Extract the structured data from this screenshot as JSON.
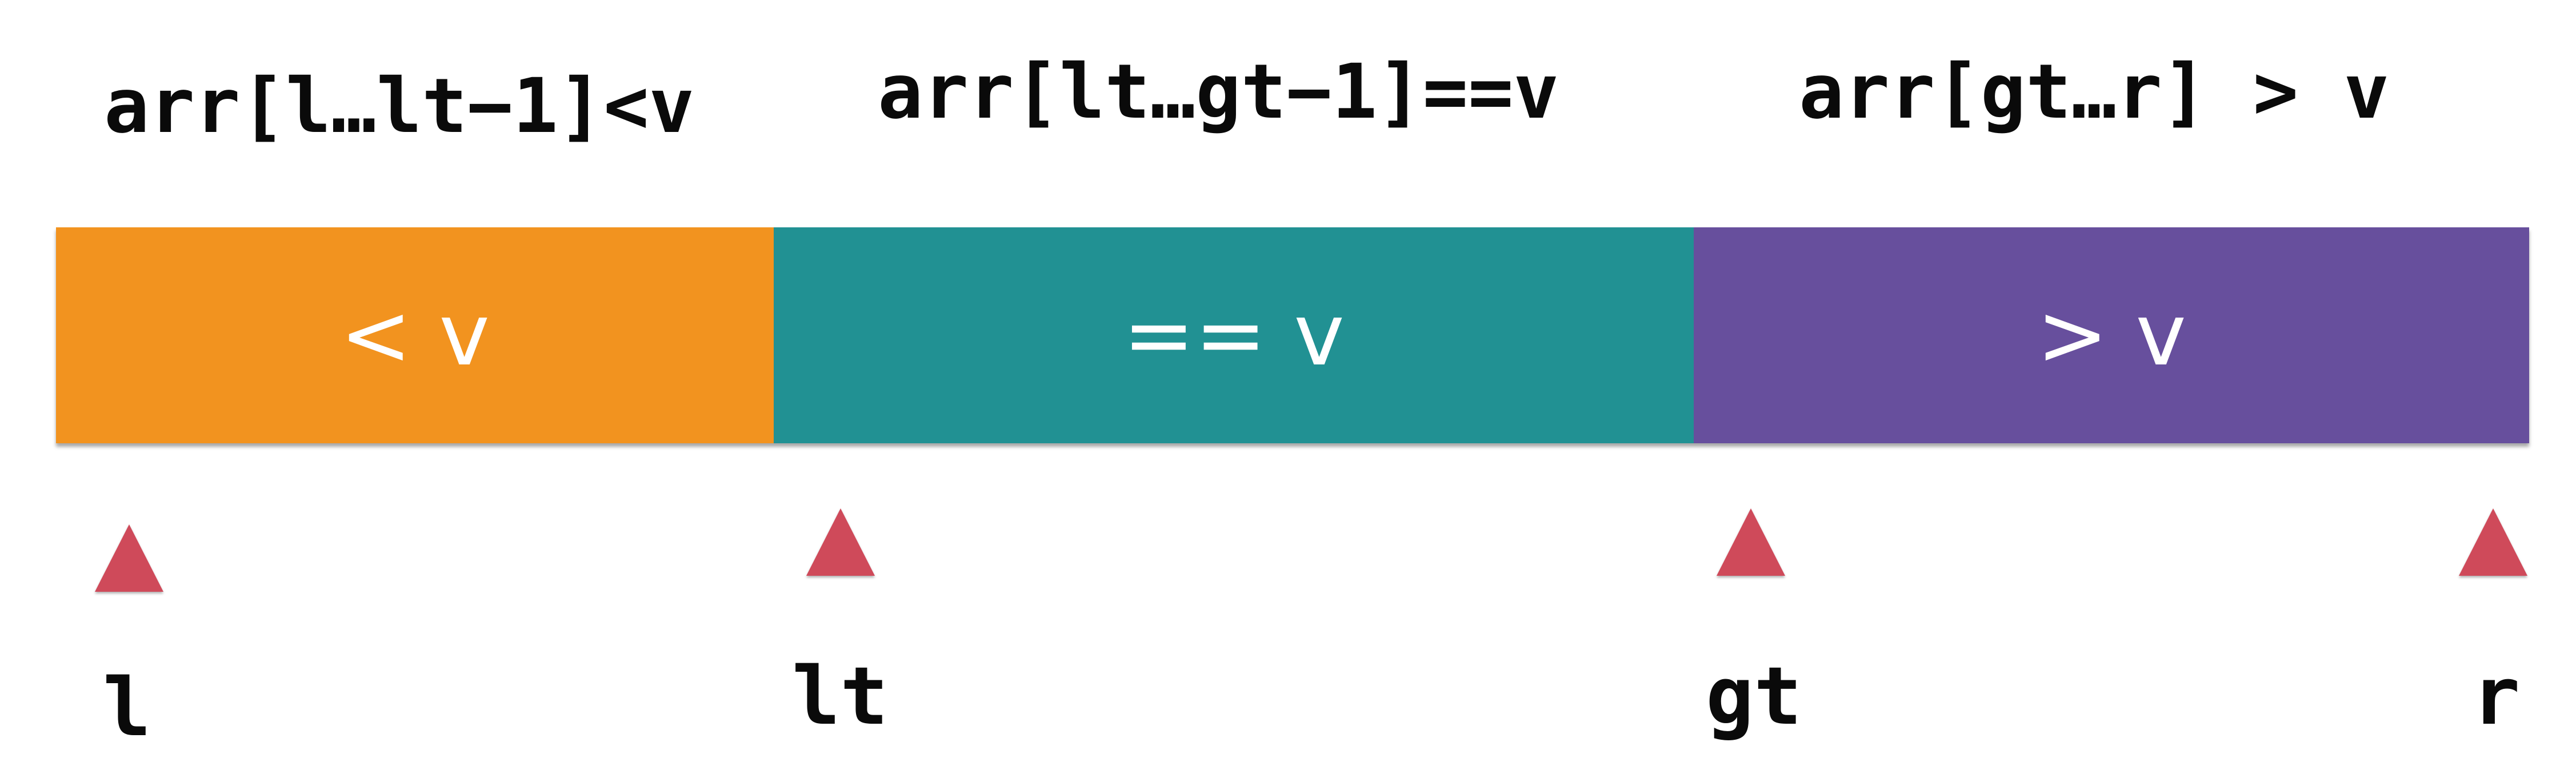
{
  "ranges": {
    "less": "arr[l…lt−1]<v",
    "equal": "arr[lt…gt−1]==v",
    "greater": "arr[gt…r] > v"
  },
  "segments": [
    {
      "label": "< v",
      "color": "#f2931f"
    },
    {
      "label": "== v",
      "color": "#219193"
    },
    {
      "label": "> v",
      "color": "#674f9d"
    }
  ],
  "marker_color": "#cf4a5a",
  "pointers": [
    "l",
    "lt",
    "gt",
    "r"
  ]
}
